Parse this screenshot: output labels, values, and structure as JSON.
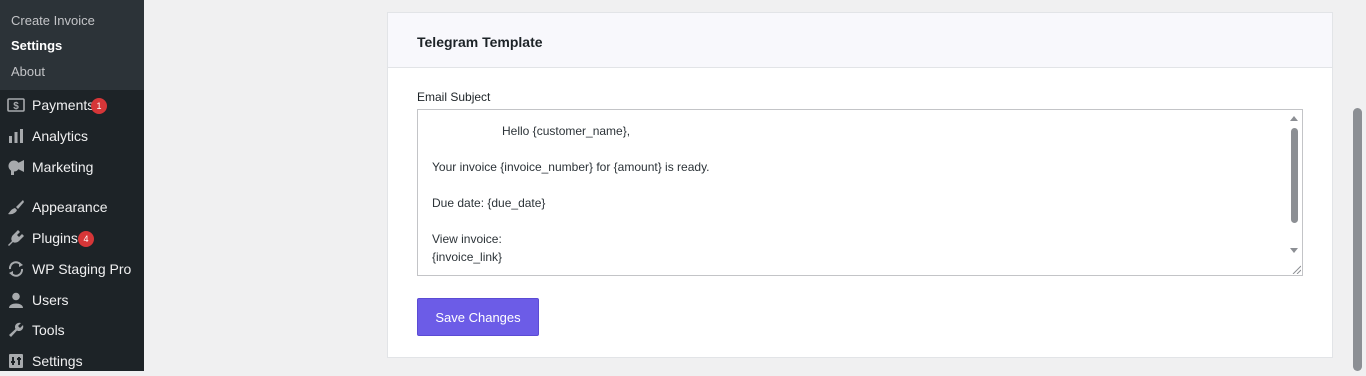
{
  "sidebar": {
    "submenu": [
      {
        "label": "Create Invoice"
      },
      {
        "label": "Settings"
      },
      {
        "label": "About"
      }
    ],
    "menu": [
      {
        "label": "Payments",
        "icon": "dollar-icon",
        "badge": "1"
      },
      {
        "label": "Analytics",
        "icon": "bar-chart-icon"
      },
      {
        "label": "Marketing",
        "icon": "megaphone-icon"
      },
      {
        "label": "Appearance",
        "icon": "paintbrush-icon"
      },
      {
        "label": "Plugins",
        "icon": "plugin-icon",
        "badge": "4"
      },
      {
        "label": "WP Staging Pro",
        "icon": "staging-icon"
      },
      {
        "label": "Users",
        "icon": "user-icon"
      },
      {
        "label": "Tools",
        "icon": "wrench-icon"
      },
      {
        "label": "Settings",
        "icon": "settings-icon"
      }
    ]
  },
  "card": {
    "title": "Telegram Template",
    "field_label": "Email Subject",
    "textarea_lines": [
      "Hello {customer_name},",
      "Your invoice {invoice_number} for {amount} is ready.",
      "Due date: {due_date}",
      "View invoice:",
      "{invoice_link}"
    ],
    "save_label": "Save Changes"
  },
  "colors": {
    "accent": "#6c5ce7",
    "sidebar_bg": "#1d2327",
    "submenu_bg": "#2c3338",
    "badge": "#d63638"
  }
}
